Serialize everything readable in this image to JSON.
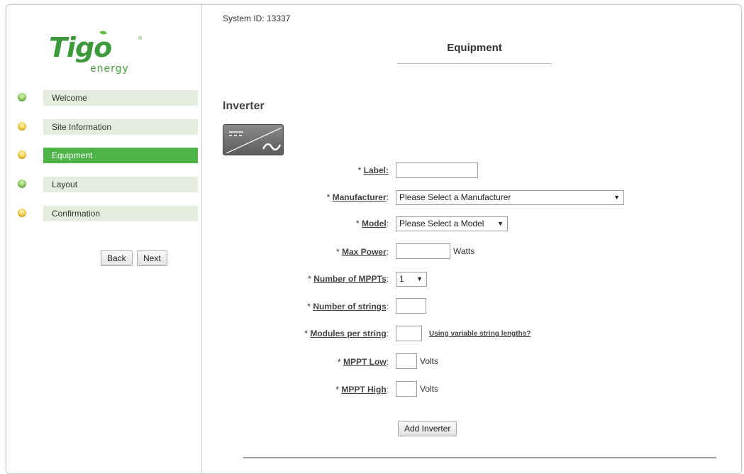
{
  "brand": {
    "name": "Tigo",
    "sub": "energy",
    "reg": "®",
    "color": "#3d9a3b"
  },
  "sidebar": {
    "items": [
      {
        "label": "Welcome",
        "status": "green"
      },
      {
        "label": "Site Information",
        "status": "yellow"
      },
      {
        "label": "Equipment",
        "status": "yellow",
        "active": true
      },
      {
        "label": "Layout",
        "status": "green"
      },
      {
        "label": "Confirmation",
        "status": "yellow"
      }
    ],
    "back_label": "Back",
    "next_label": "Next",
    "active_color": "#4db547"
  },
  "header": {
    "system_id": "System ID: 13337",
    "title": "Equipment"
  },
  "inverter": {
    "section_title": "Inverter",
    "icon": "dc-to-ac-inverter-icon",
    "fields": {
      "label": {
        "prefix": "* ",
        "text": "Label:",
        "value": ""
      },
      "manufacturer": {
        "prefix": "* ",
        "text": "Manufacturer",
        "colon": ":",
        "selected": "Please Select a Manufacturer"
      },
      "model": {
        "prefix": "* ",
        "text": "Model",
        "colon": ":",
        "selected": "Please Select a Model"
      },
      "max_power": {
        "prefix": "* ",
        "text": "Max Power",
        "colon": ":",
        "value": "",
        "unit": "Watts"
      },
      "mppts": {
        "prefix": "* ",
        "text": "Number of MPPTs",
        "colon": ":",
        "selected": "1"
      },
      "strings": {
        "prefix": "* ",
        "text": "Number of strings",
        "colon": ":",
        "value": ""
      },
      "modules": {
        "prefix": "* ",
        "text": "Modules per string",
        "colon": ":",
        "value": "",
        "link": "Using variable string lengths?"
      },
      "mppt_low": {
        "prefix": "* ",
        "text": "MPPT Low",
        "colon": ":",
        "value": "",
        "unit": "Volts"
      },
      "mppt_high": {
        "prefix": "* ",
        "text": "MPPT High",
        "colon": ":",
        "value": "",
        "unit": "Volts"
      }
    },
    "add_label": "Add Inverter"
  }
}
